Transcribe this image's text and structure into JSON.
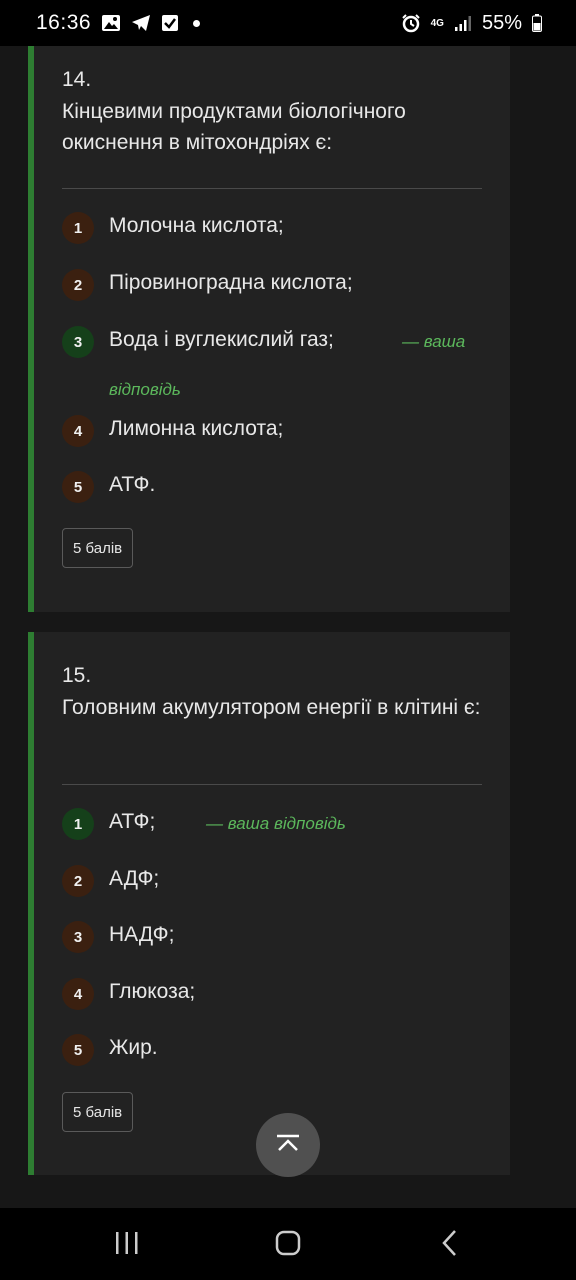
{
  "status": {
    "time": "16:36",
    "network": "4G",
    "battery": "55%"
  },
  "questions": [
    {
      "number": "14.",
      "text": "Кінцевими продуктами біологічного окиснення в мітохондріях є:",
      "options": [
        {
          "num": "1",
          "text": "Молочна кислота;"
        },
        {
          "num": "2",
          "text": "Піровиноградна кислота;"
        },
        {
          "num": "3",
          "text": "Вода і вуглекислий газ;"
        },
        {
          "num": "4",
          "text": "Лимонна кислота;"
        },
        {
          "num": "5",
          "text": "АТФ."
        }
      ],
      "your_answer_part1": "— ваша",
      "your_answer_part2": "відповідь",
      "points": "5 балів"
    },
    {
      "number": "15.",
      "text": "Головним акумулятором енергії в клітині є:",
      "options": [
        {
          "num": "1",
          "text": "АТФ;"
        },
        {
          "num": "2",
          "text": "АДФ;"
        },
        {
          "num": "3",
          "text": "НАДФ;"
        },
        {
          "num": "4",
          "text": "Глюкоза;"
        },
        {
          "num": "5",
          "text": "Жир."
        }
      ],
      "your_answer": "— ваша відповідь",
      "points": "5 балів"
    }
  ],
  "colors": {
    "accent_border": "#2e7d32",
    "answer_text": "#5cb85c",
    "correct_badge": "#15401a",
    "option_badge": "#3b2010"
  },
  "icons": {
    "scroll_top": "chevron-up-icon",
    "nav_recent": "recent-apps-icon",
    "nav_home": "home-icon",
    "nav_back": "back-icon"
  }
}
